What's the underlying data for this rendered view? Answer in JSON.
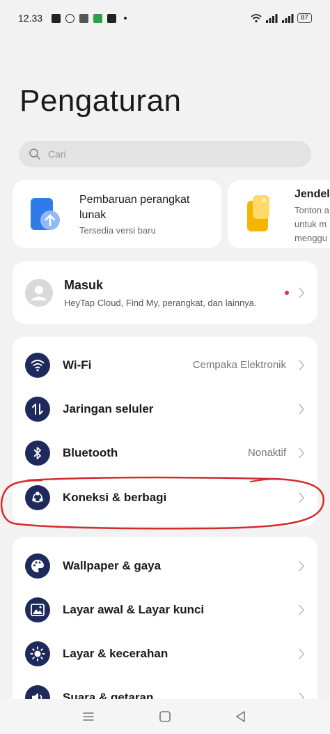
{
  "status_bar": {
    "time": "12.33",
    "battery": "87"
  },
  "page": {
    "title": "Pengaturan"
  },
  "search": {
    "placeholder": "Cari"
  },
  "promos": [
    {
      "title_line1": "Pembaruan perangkat",
      "title_line2": "lunak",
      "subtitle": "Tersedia versi baru"
    },
    {
      "title": "Jendela",
      "sub_line1": "Tonton a",
      "sub_line2": "untuk m",
      "sub_line3": "menggu"
    }
  ],
  "account": {
    "title": "Masuk",
    "subtitle": "HeyTap Cloud, Find My, perangkat, dan lainnya."
  },
  "connectivity": [
    {
      "label": "Wi-Fi",
      "value": "Cempaka Elektronik",
      "icon": "wifi-icon"
    },
    {
      "label": "Jaringan seluler",
      "value": "",
      "icon": "mobile-data-icon"
    },
    {
      "label": "Bluetooth",
      "value": "Nonaktif",
      "icon": "bluetooth-icon"
    },
    {
      "label": "Koneksi & berbagi",
      "value": "",
      "icon": "share-icon"
    }
  ],
  "personalization": [
    {
      "label": "Wallpaper & gaya",
      "icon": "palette-icon"
    },
    {
      "label": "Layar awal & Layar kunci",
      "icon": "image-icon"
    },
    {
      "label": "Layar & kecerahan",
      "icon": "brightness-icon"
    },
    {
      "label": "Suara & getaran",
      "icon": "sound-icon"
    }
  ],
  "colors": {
    "icon_bg": "#1f2a5c",
    "notification_dot": "#e0304a",
    "annotation": "#d42a2a"
  }
}
